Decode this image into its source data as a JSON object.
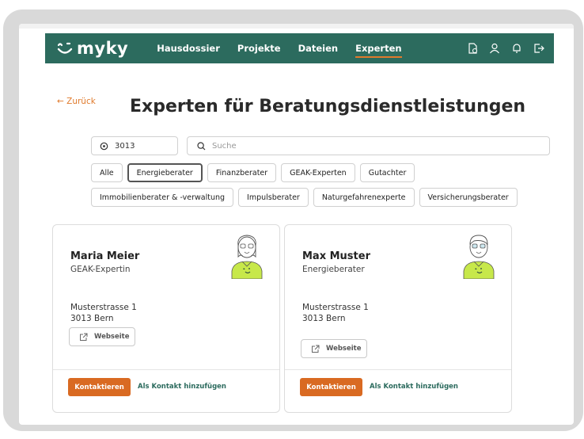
{
  "brand": {
    "logo_text": "myky",
    "accent": "#e07a2c",
    "primary": "#2c6b5e"
  },
  "nav": {
    "items": [
      {
        "label": "Hausdossier",
        "active": false
      },
      {
        "label": "Projekte",
        "active": false
      },
      {
        "label": "Dateien",
        "active": false
      },
      {
        "label": "Experten",
        "active": true
      }
    ],
    "icons": [
      "document-icon",
      "user-icon",
      "bell-icon",
      "logout-icon"
    ]
  },
  "page": {
    "back_label": "← Zurück",
    "title": "Experten für Beratungsdienstleistungen"
  },
  "filters": {
    "location_value": "3013",
    "search_placeholder": "Suche",
    "chips": [
      {
        "label": "Alle",
        "active": false
      },
      {
        "label": "Energieberater",
        "active": true
      },
      {
        "label": "Finanzberater",
        "active": false
      },
      {
        "label": "GEAK-Experten",
        "active": false
      },
      {
        "label": "Gutachter",
        "active": false
      },
      {
        "label": "Immobilienberater & -verwaltung",
        "active": false
      },
      {
        "label": "Impulsberater",
        "active": false
      },
      {
        "label": "Naturgefahrenexperte",
        "active": false
      },
      {
        "label": "Versicherungsberater",
        "active": false
      }
    ]
  },
  "experts": [
    {
      "name": "Maria Meier",
      "role": "GEAK-Expertin",
      "street": "Musterstrasse 1",
      "city": "3013 Bern",
      "website_label": "Webseite",
      "contact_label": "Kontaktieren",
      "add_contact_label": "Als Kontakt hinzufügen"
    },
    {
      "name": "Max Muster",
      "role": "Energieberater",
      "street": "Musterstrasse 1",
      "city": "3013 Bern",
      "website_label": "Webseite",
      "contact_label": "Kontaktieren",
      "add_contact_label": "Als Kontakt hinzufügen"
    }
  ]
}
